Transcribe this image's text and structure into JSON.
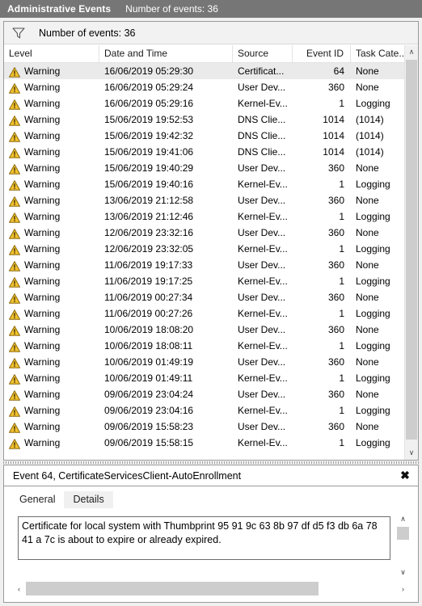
{
  "title_bar": {
    "main": "Administrative Events",
    "sub": "Number of events: 36"
  },
  "filter_bar": {
    "icon": "funnel-icon",
    "label": "Number of events: 36"
  },
  "table": {
    "columns": [
      {
        "key": "level",
        "label": "Level"
      },
      {
        "key": "date",
        "label": "Date and Time"
      },
      {
        "key": "source",
        "label": "Source"
      },
      {
        "key": "event_id",
        "label": "Event ID"
      },
      {
        "key": "task_category",
        "label": "Task Cate..."
      }
    ],
    "rows": [
      {
        "icon": "warning-icon",
        "level": "Warning",
        "date": "16/06/2019 05:29:30",
        "source": "Certificat...",
        "event_id": "64",
        "task_category": "None",
        "selected": true
      },
      {
        "icon": "warning-icon",
        "level": "Warning",
        "date": "16/06/2019 05:29:24",
        "source": "User Dev...",
        "event_id": "360",
        "task_category": "None",
        "selected": false
      },
      {
        "icon": "warning-icon",
        "level": "Warning",
        "date": "16/06/2019 05:29:16",
        "source": "Kernel-Ev...",
        "event_id": "1",
        "task_category": "Logging",
        "selected": false
      },
      {
        "icon": "warning-icon",
        "level": "Warning",
        "date": "15/06/2019 19:52:53",
        "source": "DNS Clie...",
        "event_id": "1014",
        "task_category": "(1014)",
        "selected": false
      },
      {
        "icon": "warning-icon",
        "level": "Warning",
        "date": "15/06/2019 19:42:32",
        "source": "DNS Clie...",
        "event_id": "1014",
        "task_category": "(1014)",
        "selected": false
      },
      {
        "icon": "warning-icon",
        "level": "Warning",
        "date": "15/06/2019 19:41:06",
        "source": "DNS Clie...",
        "event_id": "1014",
        "task_category": "(1014)",
        "selected": false
      },
      {
        "icon": "warning-icon",
        "level": "Warning",
        "date": "15/06/2019 19:40:29",
        "source": "User Dev...",
        "event_id": "360",
        "task_category": "None",
        "selected": false
      },
      {
        "icon": "warning-icon",
        "level": "Warning",
        "date": "15/06/2019 19:40:16",
        "source": "Kernel-Ev...",
        "event_id": "1",
        "task_category": "Logging",
        "selected": false
      },
      {
        "icon": "warning-icon",
        "level": "Warning",
        "date": "13/06/2019 21:12:58",
        "source": "User Dev...",
        "event_id": "360",
        "task_category": "None",
        "selected": false
      },
      {
        "icon": "warning-icon",
        "level": "Warning",
        "date": "13/06/2019 21:12:46",
        "source": "Kernel-Ev...",
        "event_id": "1",
        "task_category": "Logging",
        "selected": false
      },
      {
        "icon": "warning-icon",
        "level": "Warning",
        "date": "12/06/2019 23:32:16",
        "source": "User Dev...",
        "event_id": "360",
        "task_category": "None",
        "selected": false
      },
      {
        "icon": "warning-icon",
        "level": "Warning",
        "date": "12/06/2019 23:32:05",
        "source": "Kernel-Ev...",
        "event_id": "1",
        "task_category": "Logging",
        "selected": false
      },
      {
        "icon": "warning-icon",
        "level": "Warning",
        "date": "11/06/2019 19:17:33",
        "source": "User Dev...",
        "event_id": "360",
        "task_category": "None",
        "selected": false
      },
      {
        "icon": "warning-icon",
        "level": "Warning",
        "date": "11/06/2019 19:17:25",
        "source": "Kernel-Ev...",
        "event_id": "1",
        "task_category": "Logging",
        "selected": false
      },
      {
        "icon": "warning-icon",
        "level": "Warning",
        "date": "11/06/2019 00:27:34",
        "source": "User Dev...",
        "event_id": "360",
        "task_category": "None",
        "selected": false
      },
      {
        "icon": "warning-icon",
        "level": "Warning",
        "date": "11/06/2019 00:27:26",
        "source": "Kernel-Ev...",
        "event_id": "1",
        "task_category": "Logging",
        "selected": false
      },
      {
        "icon": "warning-icon",
        "level": "Warning",
        "date": "10/06/2019 18:08:20",
        "source": "User Dev...",
        "event_id": "360",
        "task_category": "None",
        "selected": false
      },
      {
        "icon": "warning-icon",
        "level": "Warning",
        "date": "10/06/2019 18:08:11",
        "source": "Kernel-Ev...",
        "event_id": "1",
        "task_category": "Logging",
        "selected": false
      },
      {
        "icon": "warning-icon",
        "level": "Warning",
        "date": "10/06/2019 01:49:19",
        "source": "User Dev...",
        "event_id": "360",
        "task_category": "None",
        "selected": false
      },
      {
        "icon": "warning-icon",
        "level": "Warning",
        "date": "10/06/2019 01:49:11",
        "source": "Kernel-Ev...",
        "event_id": "1",
        "task_category": "Logging",
        "selected": false
      },
      {
        "icon": "warning-icon",
        "level": "Warning",
        "date": "09/06/2019 23:04:24",
        "source": "User Dev...",
        "event_id": "360",
        "task_category": "None",
        "selected": false
      },
      {
        "icon": "warning-icon",
        "level": "Warning",
        "date": "09/06/2019 23:04:16",
        "source": "Kernel-Ev...",
        "event_id": "1",
        "task_category": "Logging",
        "selected": false
      },
      {
        "icon": "warning-icon",
        "level": "Warning",
        "date": "09/06/2019 15:58:23",
        "source": "User Dev...",
        "event_id": "360",
        "task_category": "None",
        "selected": false
      },
      {
        "icon": "warning-icon",
        "level": "Warning",
        "date": "09/06/2019 15:58:15",
        "source": "Kernel-Ev...",
        "event_id": "1",
        "task_category": "Logging",
        "selected": false
      }
    ],
    "scrollbar": {
      "up": "∧",
      "down": "∨"
    }
  },
  "detail": {
    "header_title": "Event 64, CertificateServicesClient-AutoEnrollment",
    "close_label": "✖",
    "tabs": [
      {
        "label": "General",
        "active": true
      },
      {
        "label": "Details",
        "active": false
      }
    ],
    "message": "Certificate for local system with Thumbprint 95 91 9c 63 8b 97 df d5 f3 db 6a 78 41 a 7c is about to expire or already expired.",
    "scroll_up": "∧",
    "scroll_down": "∨",
    "scroll_left": "‹",
    "scroll_right": "›"
  },
  "colors": {
    "titlebar_bg": "#767676",
    "warning_yellow": "#f2c12e",
    "selection": "#eaeaea"
  }
}
